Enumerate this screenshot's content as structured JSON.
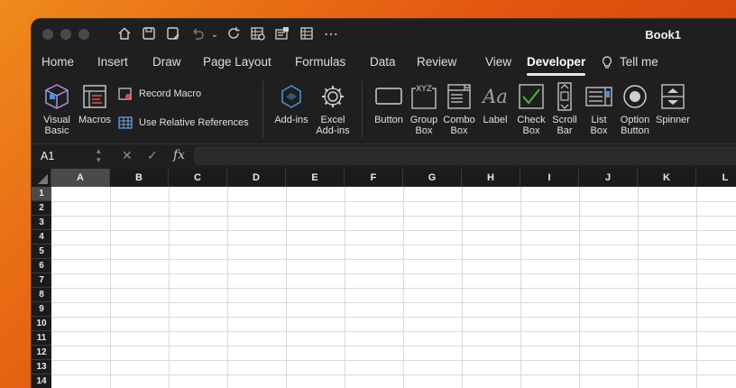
{
  "window": {
    "title": "Book1"
  },
  "quick_access": [
    "home-icon",
    "save-icon",
    "save-as-icon",
    "undo-icon",
    "undo-dropdown-icon",
    "redo-icon",
    "print-preview-icon",
    "form-icon",
    "table-icon",
    "more-icon"
  ],
  "tabs": [
    {
      "label": "Home"
    },
    {
      "label": "Insert"
    },
    {
      "label": "Draw"
    },
    {
      "label": "Page Layout"
    },
    {
      "label": "Formulas"
    },
    {
      "label": "Data"
    },
    {
      "label": "Review"
    },
    {
      "label": "View"
    },
    {
      "label": "Developer",
      "active": true
    },
    {
      "label": "Tell me"
    }
  ],
  "ribbon": {
    "visual_basic": "Visual\nBasic",
    "macros": "Macros",
    "record_macro": "Record Macro",
    "use_relative": "Use Relative References",
    "add_ins": "Add-ins",
    "excel_add_ins": "Excel\nAdd-ins",
    "button": "Button",
    "group_box": "Group\nBox",
    "combo_box": "Combo\nBox",
    "label": "Label",
    "check_box": "Check\nBox",
    "scroll_bar": "Scroll\nBar",
    "list_box": "List\nBox",
    "option_button": "Option\nButton",
    "spinner": "Spinner",
    "group_box_caption": "XYZ",
    "label_glyph": "Aa"
  },
  "formula_bar": {
    "name_box": "A1",
    "cancel": "✕",
    "enter": "✓",
    "fx": "fx",
    "value": ""
  },
  "sheet": {
    "columns": [
      "A",
      "B",
      "C",
      "D",
      "E",
      "F",
      "G",
      "H",
      "I",
      "J",
      "K",
      "L"
    ],
    "rows": [
      "1",
      "2",
      "3",
      "4",
      "5",
      "6",
      "7",
      "8",
      "9",
      "10",
      "11",
      "12",
      "13",
      "14"
    ],
    "active_cell": "A1"
  },
  "colors": {
    "accent_green": "#4caf50",
    "selected_header": "#4a4a4a"
  }
}
